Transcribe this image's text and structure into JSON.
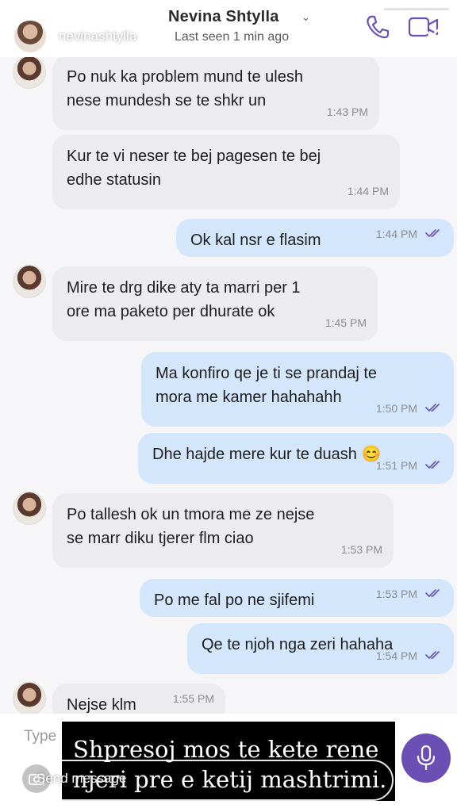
{
  "story": {
    "username": "nevinashtylla",
    "progress": [
      1,
      1,
      1,
      0.4
    ]
  },
  "header": {
    "contact_name": "Nevina Shtylla",
    "last_seen": "Last seen 1 min ago"
  },
  "messages": [
    {
      "dir": "in",
      "avatar": true,
      "text": "Po nuk ka problem mund te ulesh\nnese mundesh se te shkr un",
      "time": "1:43 PM"
    },
    {
      "dir": "in",
      "avatar": false,
      "text": "Kur te vi neser te bej pagesen te bej\nedhe statusin",
      "time": "1:44 PM"
    },
    {
      "dir": "out",
      "text": "Ok kal nsr e flasim",
      "time": "1:44 PM"
    },
    {
      "dir": "in",
      "avatar": true,
      "text": "Mire te drg dike aty ta marri per 1\nore ma paketo per dhurate ok",
      "time": "1:45 PM"
    },
    {
      "dir": "out",
      "text": "Ma konfiro qe je ti se prandaj te\nmora me kamer hahahahh",
      "time": "1:50 PM"
    },
    {
      "dir": "out",
      "text": "Dhe hajde mere kur te duash 😊",
      "time": "1:51 PM"
    },
    {
      "dir": "in",
      "avatar": true,
      "text": "Po tallesh ok un tmora me ze nejse\nse marr diku tjerer flm  ciao",
      "time": "1:53 PM"
    },
    {
      "dir": "out",
      "text": "Po me fal po ne sjifemi",
      "time": "1:53 PM"
    },
    {
      "dir": "out",
      "text": "Qe te njoh nga zeri hahaha",
      "time": "1:54 PM"
    },
    {
      "dir": "in",
      "avatar": true,
      "text": "Nejse klm",
      "time": "1:55 PM"
    }
  ],
  "composer": {
    "placeholder": "Type"
  },
  "story_reply": {
    "placeholder": "Send message"
  },
  "caption": {
    "line1": "Shpresoj mos te kete rene",
    "line2": "njeri pre e ketij mashtrimi."
  },
  "colors": {
    "incoming_bubble": "#ececee",
    "outgoing_bubble": "#d3e6fb",
    "accent": "#6b4fb5"
  }
}
